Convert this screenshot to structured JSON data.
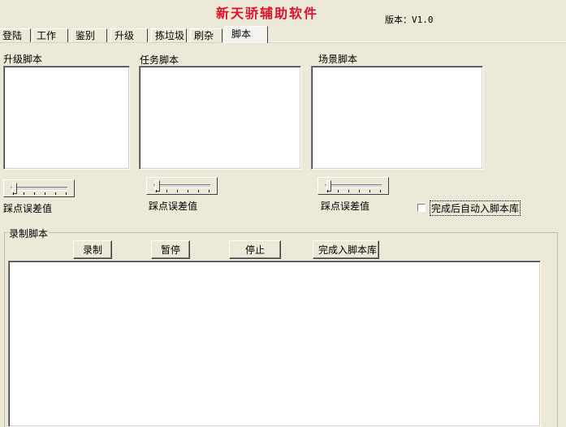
{
  "header": {
    "title": "新天骄辅助软件",
    "version": "版本：V1.0"
  },
  "tabs": [
    {
      "label": "登陆",
      "active": false
    },
    {
      "label": "工作",
      "active": false
    },
    {
      "label": "鉴别",
      "active": false
    },
    {
      "label": "升级",
      "active": false
    },
    {
      "label": "拣垃圾",
      "active": false
    },
    {
      "label": "刷杂",
      "active": false
    },
    {
      "label": "脚本",
      "active": true
    }
  ],
  "panels": {
    "upgrade_script_label": "升级脚本",
    "task_script_label": "任务脚本",
    "scene_script_label": "场景脚本"
  },
  "sliders": {
    "label_1": "踩点误差值",
    "label_2": "踩点误差值",
    "label_3": "踩点误差值"
  },
  "auto_import_checkbox": {
    "label": "完成后自动入脚本库",
    "checked": false
  },
  "record_group": {
    "title": "录制脚本",
    "record_button": "录制",
    "pause_button": "暂停",
    "stop_button": "停止",
    "finish_button": "完成入脚本库"
  }
}
